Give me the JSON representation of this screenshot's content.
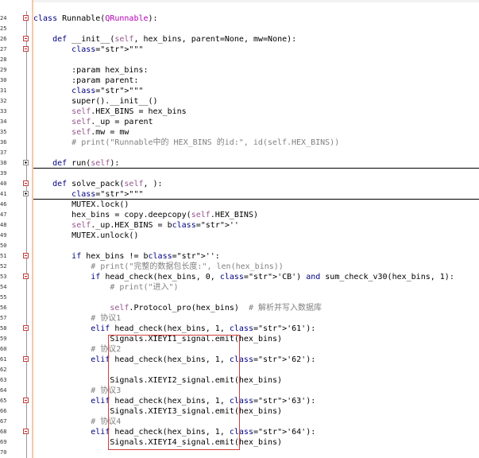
{
  "rows": [
    {
      "ln": "24",
      "fold": "minus",
      "text": "class Runnable(QRunnable):"
    },
    {
      "ln": "25",
      "fold": "",
      "text": ""
    },
    {
      "ln": "26",
      "fold": "minus",
      "text": "    def __init__(self, hex_bins, parent=None, mw=None):"
    },
    {
      "ln": "27",
      "fold": "minus",
      "text": "        \"\"\""
    },
    {
      "ln": "28",
      "fold": "",
      "text": ""
    },
    {
      "ln": "29",
      "fold": "",
      "text": "        :param hex_bins:"
    },
    {
      "ln": "30",
      "fold": "",
      "text": "        :param parent:"
    },
    {
      "ln": "31",
      "fold": "",
      "text": "        \"\"\""
    },
    {
      "ln": "32",
      "fold": "",
      "text": "        super().__init__()"
    },
    {
      "ln": "33",
      "fold": "",
      "text": "        self.HEX_BINS = hex_bins"
    },
    {
      "ln": "34",
      "fold": "",
      "text": "        self._up = parent"
    },
    {
      "ln": "35",
      "fold": "",
      "text": "        self.mw = mw"
    },
    {
      "ln": "36",
      "fold": "",
      "text": "        # print(\"Runnable中的 HEX_BINS 的id:\", id(self.HEX_BINS))"
    },
    {
      "ln": "37",
      "fold": "",
      "text": ""
    },
    {
      "ln": "38",
      "fold": "plus",
      "text": "    def run(self):"
    },
    {
      "ln": "39",
      "fold": "",
      "text": ""
    },
    {
      "ln": "40",
      "fold": "minus",
      "text": "    def solve_pack(self, ):"
    },
    {
      "ln": "41",
      "fold": "plus",
      "text": "        \"\"\""
    },
    {
      "ln": "46",
      "fold": "",
      "text": "        MUTEX.lock()"
    },
    {
      "ln": "47",
      "fold": "",
      "text": "        hex_bins = copy.deepcopy(self.HEX_BINS)"
    },
    {
      "ln": "48",
      "fold": "",
      "text": "        self._up.HEX_BINS = b''"
    },
    {
      "ln": "49",
      "fold": "",
      "text": "        MUTEX.unlock()"
    },
    {
      "ln": "50",
      "fold": "",
      "text": ""
    },
    {
      "ln": "51",
      "fold": "minus",
      "text": "        if hex_bins != b'':"
    },
    {
      "ln": "52",
      "fold": "",
      "text": "            # print(\"完整的数据包长度:\", len(hex_bins))"
    },
    {
      "ln": "53",
      "fold": "minus",
      "text": "            if head_check(hex_bins, 0, 'CB') and sum_check_v30(hex_bins, 1):"
    },
    {
      "ln": "54",
      "fold": "",
      "text": "                # print(\"进入\")"
    },
    {
      "ln": "55",
      "fold": "",
      "text": ""
    },
    {
      "ln": "56",
      "fold": "",
      "text": "                self.Protocol_pro(hex_bins)  # 解析并写入数据库"
    },
    {
      "ln": "57",
      "fold": "",
      "text": "            # 协议1"
    },
    {
      "ln": "58",
      "fold": "minus",
      "text": "            elif head_check(hex_bins, 1, '61'):"
    },
    {
      "ln": "59",
      "fold": "",
      "text": "                Signals.XIEYI1_signal.emit(hex_bins)"
    },
    {
      "ln": "60",
      "fold": "",
      "text": "            # 协议2"
    },
    {
      "ln": "61",
      "fold": "minus",
      "text": "            elif head_check(hex_bins, 1, '62'):"
    },
    {
      "ln": "62",
      "fold": "",
      "text": ""
    },
    {
      "ln": "63",
      "fold": "",
      "text": "                Signals.XIEYI2_signal.emit(hex_bins)"
    },
    {
      "ln": "64",
      "fold": "",
      "text": "            # 协议3"
    },
    {
      "ln": "65",
      "fold": "minus",
      "text": "            elif head_check(hex_bins, 1, '63'):"
    },
    {
      "ln": "66",
      "fold": "",
      "text": "                Signals.XIEYI3_signal.emit(hex_bins)"
    },
    {
      "ln": "67",
      "fold": "",
      "text": "            # 协议4"
    },
    {
      "ln": "68",
      "fold": "minus",
      "text": "            elif head_check(hex_bins, 1, '64'):"
    },
    {
      "ln": "69",
      "fold": "",
      "text": "                Signals.XIEYI4_signal.emit(hex_bins)"
    },
    {
      "ln": "70",
      "fold": "",
      "text": ""
    }
  ],
  "colors": {
    "keyword": "#000080",
    "self": "#94558d",
    "string": "#008000",
    "comment": "#808080",
    "highlight_box": "#d04040"
  }
}
